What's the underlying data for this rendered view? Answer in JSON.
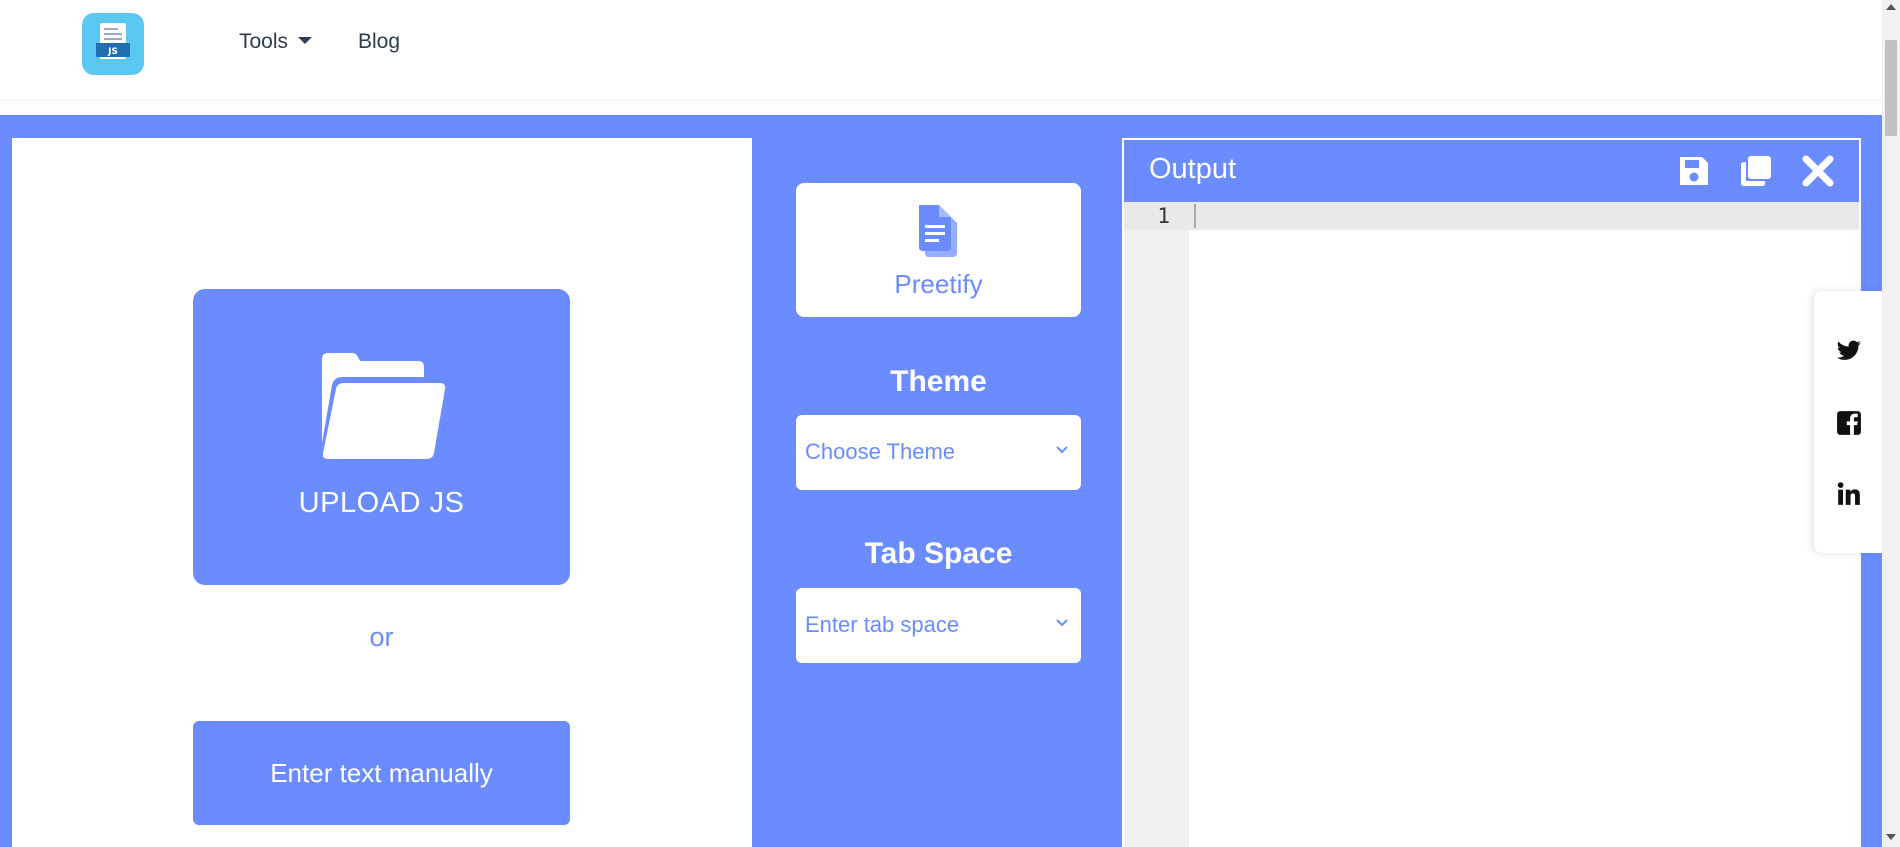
{
  "nav": {
    "logo_text": "JS",
    "tools_label": "Tools",
    "blog_label": "Blog"
  },
  "upload": {
    "label": "UPLOAD JS",
    "or_text": "or",
    "manual_label": "Enter text manually"
  },
  "controls": {
    "prettify_label": "Preetify",
    "theme_title": "Theme",
    "theme_placeholder": "Choose Theme",
    "tab_title": "Tab Space",
    "tab_placeholder": "Enter tab space"
  },
  "output": {
    "title": "Output",
    "line_number": "1"
  },
  "icons": {
    "save": "save-icon",
    "copy": "copy-icon",
    "close": "close-icon",
    "twitter": "twitter-icon",
    "facebook": "facebook-icon",
    "linkedin": "linkedin-icon"
  },
  "colors": {
    "accent": "#6a8cff",
    "logo_bg": "#5bc8f2",
    "white": "#ffffff"
  }
}
